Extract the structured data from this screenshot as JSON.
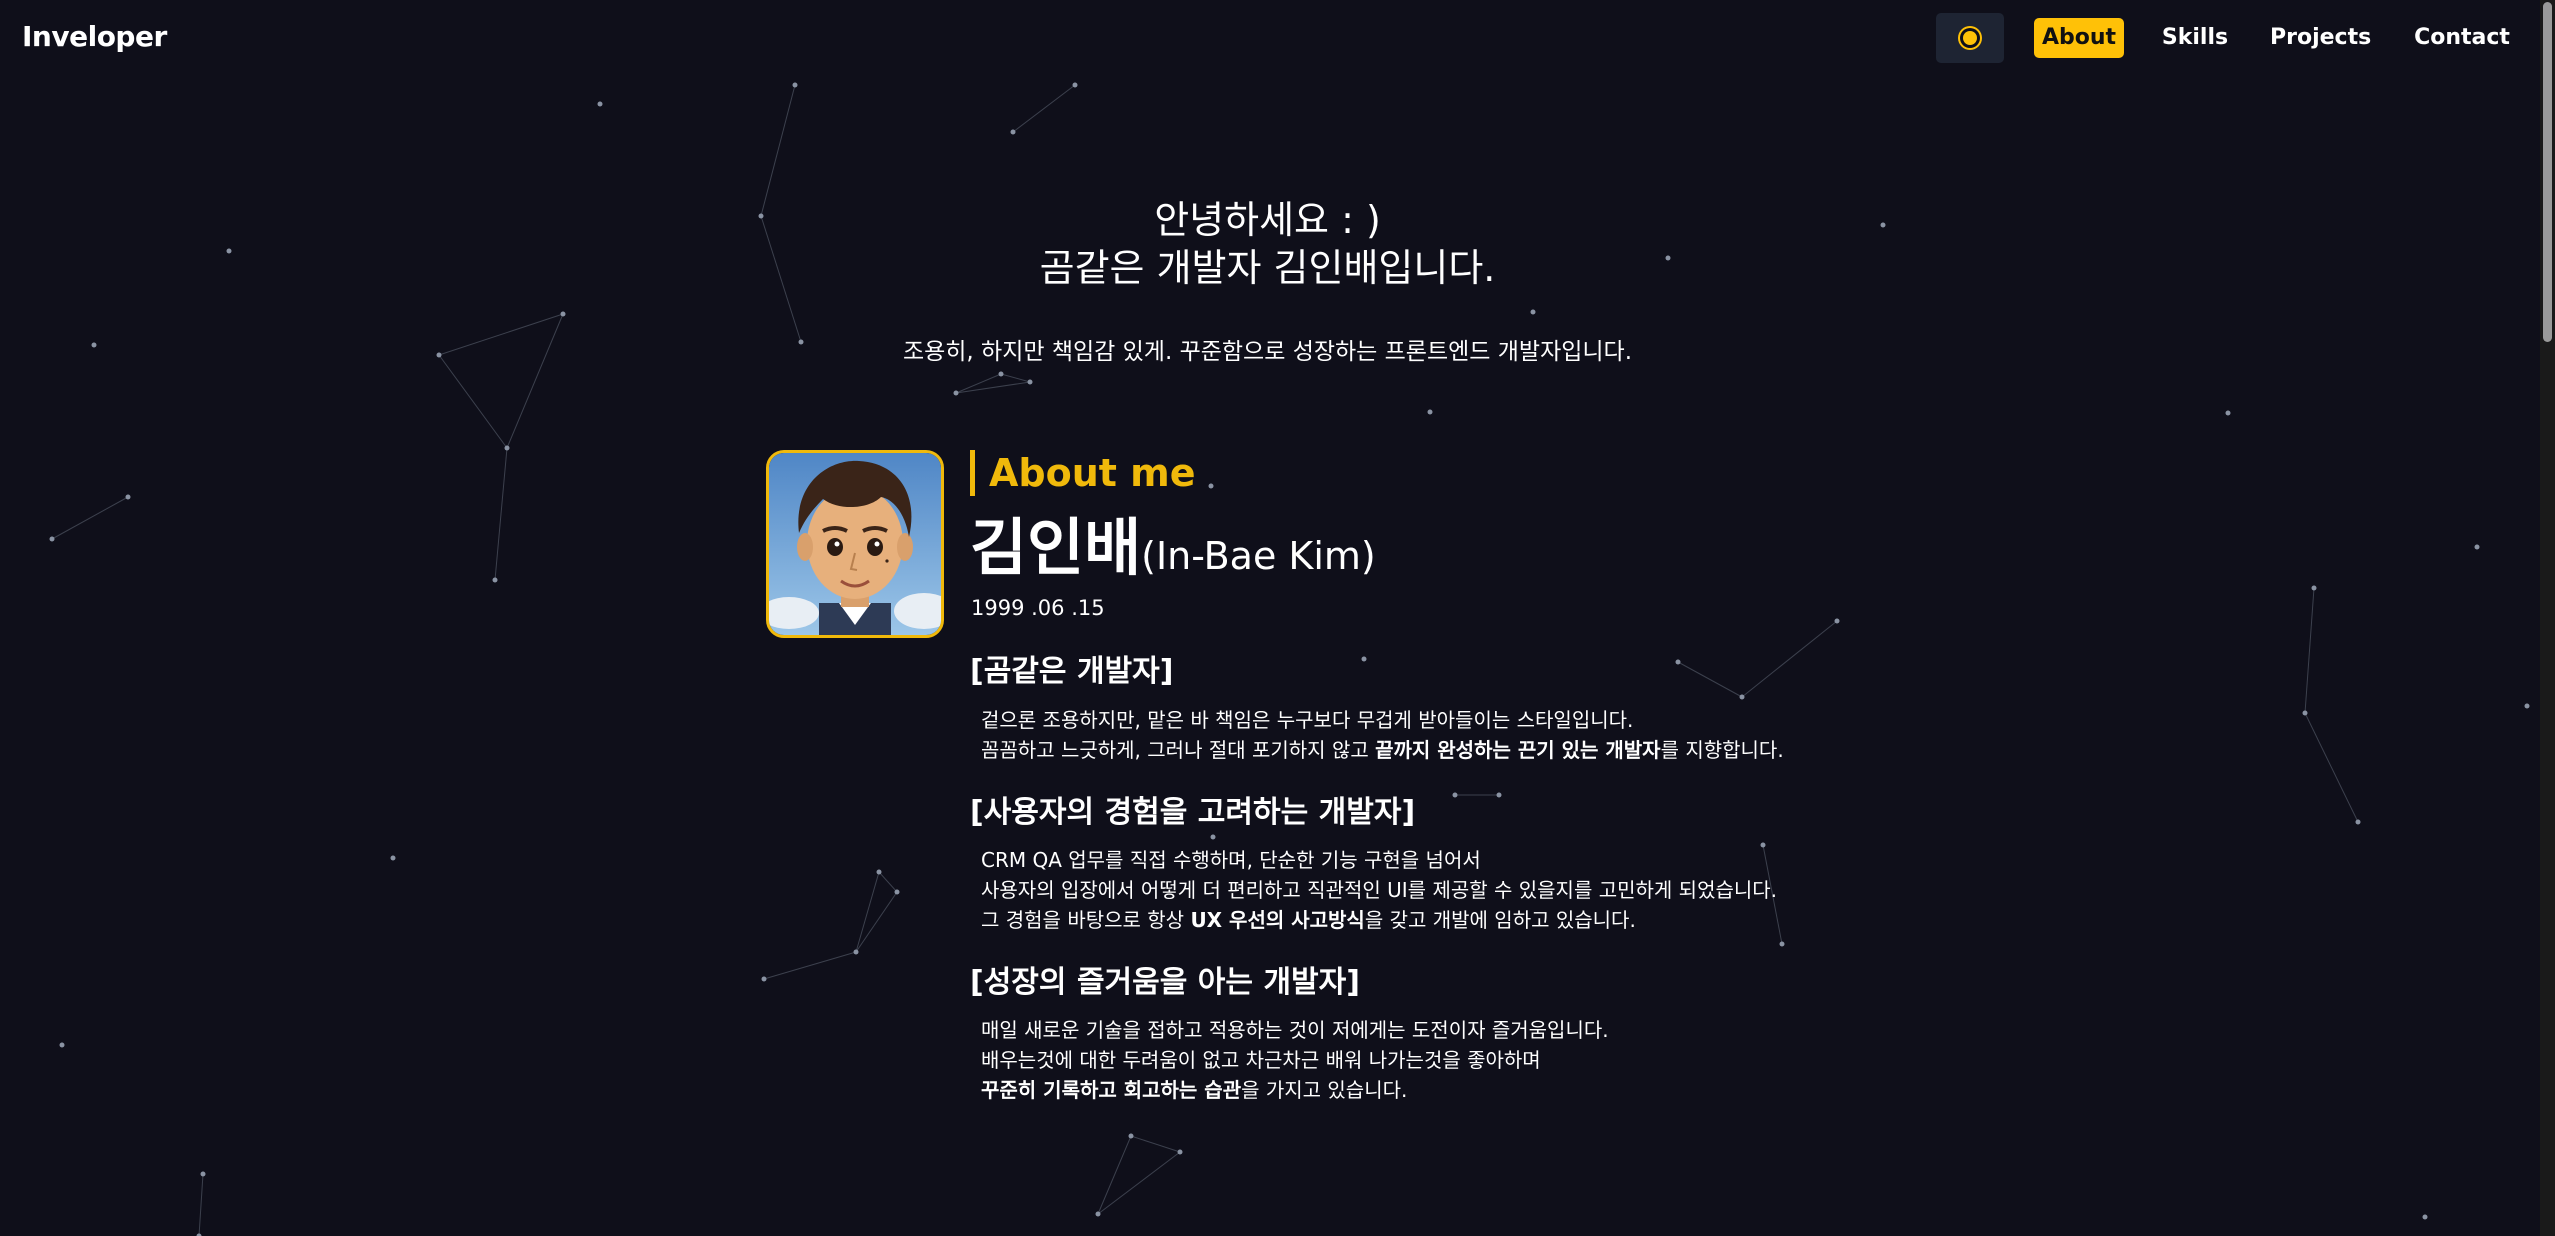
{
  "header": {
    "logo": "Inveloper",
    "theme_icon": "sun-icon",
    "nav": [
      "About",
      "Skills",
      "Projects",
      "Contact"
    ],
    "accent_color": "#ffc107"
  },
  "hero": {
    "greeting_line1": "안녕하세요 : )",
    "greeting_line2": "곰같은 개발자 김인배입니다.",
    "tagline": "조용히, 하지만 책임감 있게. 꾸준함으로 성장하는 프론트엔드 개발자입니다."
  },
  "about": {
    "section_title": "About me",
    "name_ko": "김인배",
    "name_en": "(In-Bae Kim)",
    "birth": "1999 .06 .15",
    "blocks": [
      {
        "heading": "[곰같은 개발자]",
        "lines": [
          "겉으론 조용하지만, 맡은 바 책임은 누구보다 무겁게 받아들이는 스타일입니다.",
          [
            "꼼꼼하고 느긋하게, 그러나 절대 포기하지 않고 ",
            "끝까지 완성하는 끈기 있는 개발자",
            "를 지향합니다."
          ]
        ]
      },
      {
        "heading": "[사용자의 경험을 고려하는 개발자]",
        "lines": [
          "CRM QA 업무를 직접 수행하며, 단순한 기능 구현을 넘어서",
          "사용자의 입장에서 어떻게 더 편리하고 직관적인 UI를 제공할 수 있을지를 고민하게 되었습니다.",
          [
            "그 경험을 바탕으로 항상 ",
            "UX 우선의 사고방식",
            "을 갖고 개발에 임하고 있습니다."
          ]
        ]
      },
      {
        "heading": "[성장의 즐거움을 아는 개발자]",
        "lines": [
          "매일 새로운 기술을 접하고 적용하는 것이 저에게는 도전이자 즐거움입니다.",
          "배우는것에 대한 두려움이 없고 차근차근 배워 나가는것을 좋아하며",
          [
            "",
            "꾸준히 기록하고 회고하는 습관",
            "을 가지고 있습니다."
          ]
        ]
      }
    ]
  }
}
